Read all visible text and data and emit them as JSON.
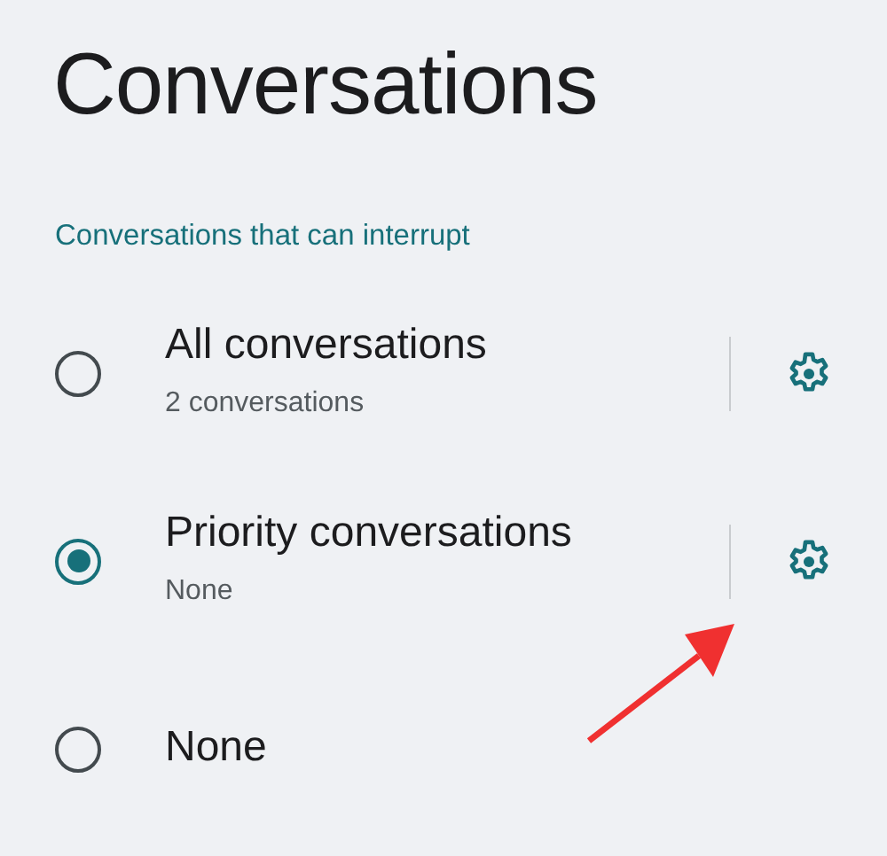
{
  "title": "Conversations",
  "section": {
    "header": "Conversations that can interrupt",
    "options": [
      {
        "label": "All conversations",
        "summary": "2 conversations",
        "selected": false,
        "settings": true
      },
      {
        "label": "Priority conversations",
        "summary": "None",
        "selected": true,
        "settings": true
      },
      {
        "label": "None",
        "selected": false,
        "settings": false
      }
    ]
  }
}
